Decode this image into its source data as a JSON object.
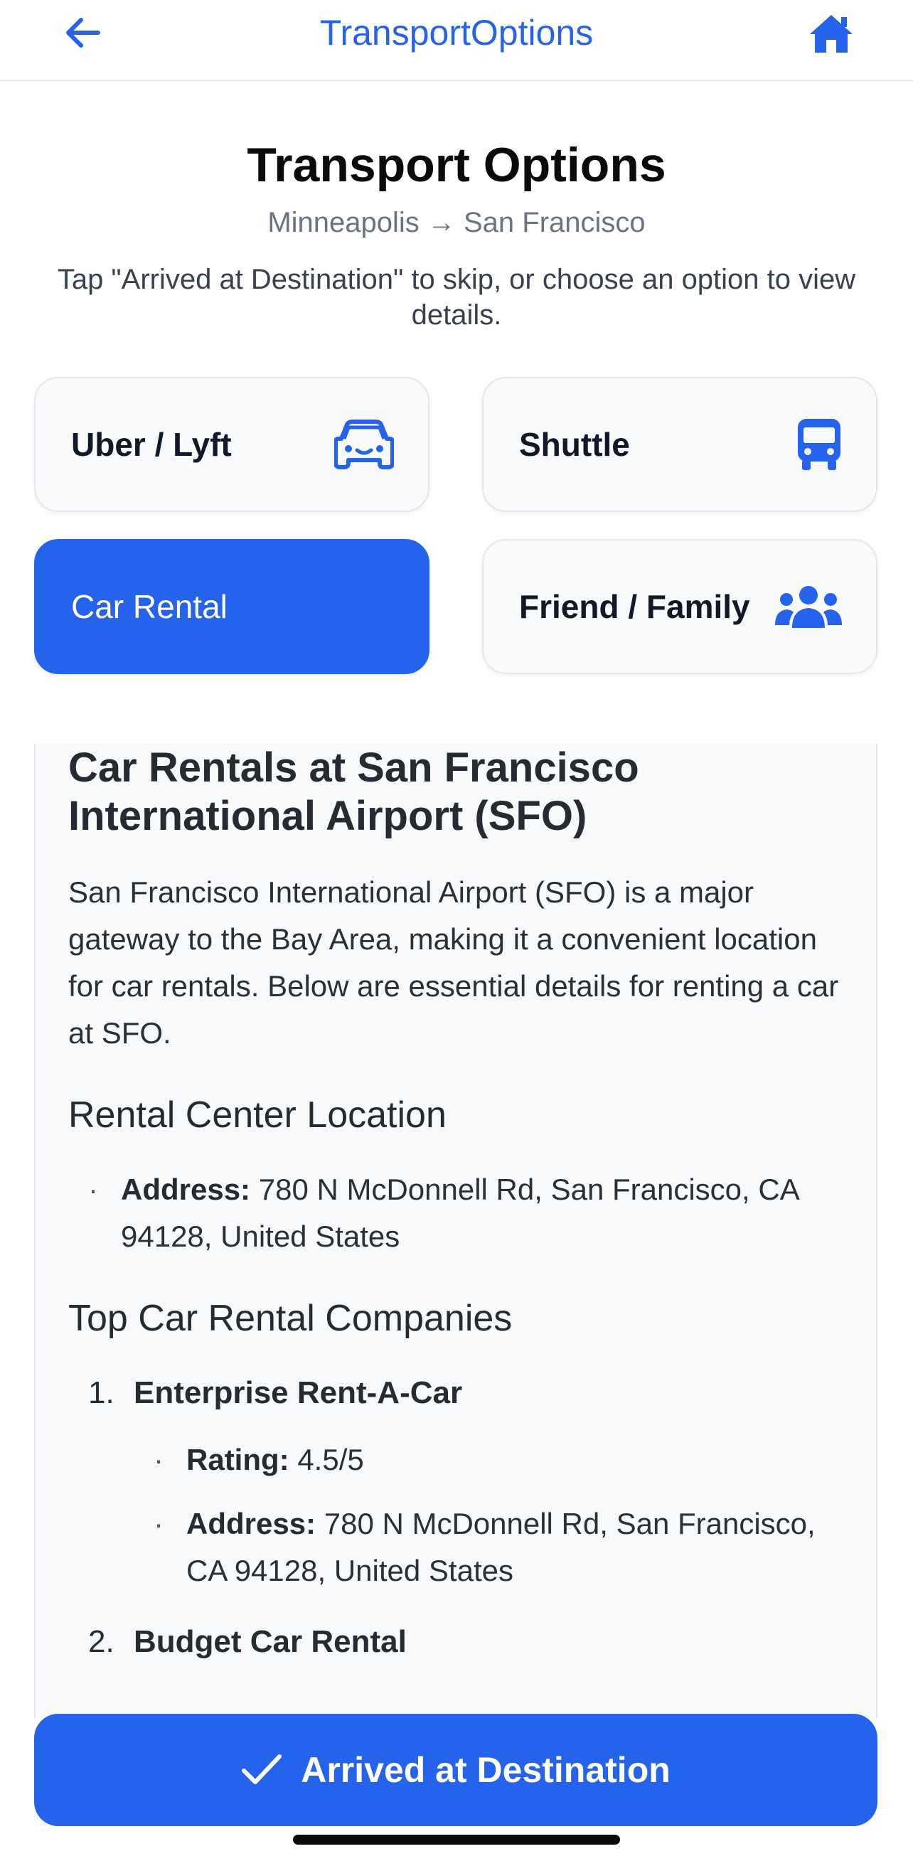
{
  "nav": {
    "title": "TransportOptions",
    "back_icon": "arrow-left-icon",
    "home_icon": "home-icon"
  },
  "header": {
    "title": "Transport Options",
    "route": "Minneapolis → San Francisco",
    "hint": "Tap \"Arrived at Destination\" to skip, or choose an option to view details."
  },
  "options": [
    {
      "label": "Uber / Lyft",
      "icon": "car-icon",
      "selected": false
    },
    {
      "label": "Shuttle",
      "icon": "bus-icon",
      "selected": false
    },
    {
      "label": "Car Rental",
      "icon": "",
      "selected": true
    },
    {
      "label": "Friend / Family",
      "icon": "users-icon",
      "selected": false
    }
  ],
  "details": {
    "title": "Car Rentals at San Francisco International Airport (SFO)",
    "intro": "San Francisco International Airport (SFO) is a major gateway to the Bay Area, making it a convenient location for car rentals. Below are essential details for renting a car at SFO.",
    "location_heading": "Rental Center Location",
    "location_label": "Address:",
    "location_value": "780 N McDonnell Rd, San Francisco, CA 94128, United States",
    "companies_heading": "Top Car Rental Companies",
    "companies": [
      {
        "number": "1.",
        "name": "Enterprise Rent-A-Car",
        "rating_label": "Rating:",
        "rating": "4.5/5",
        "address_label": "Address:",
        "address": "780 N McDonnell Rd, San Francisco, CA 94128, United States"
      },
      {
        "number": "2.",
        "name": "Budget Car Rental"
      }
    ]
  },
  "cta": {
    "label": "Arrived at Destination",
    "icon": "checkmark-icon"
  },
  "colors": {
    "accent": "#2563eb",
    "card_bg": "#f9fafb",
    "panel_bg": "#f8f9fb"
  }
}
